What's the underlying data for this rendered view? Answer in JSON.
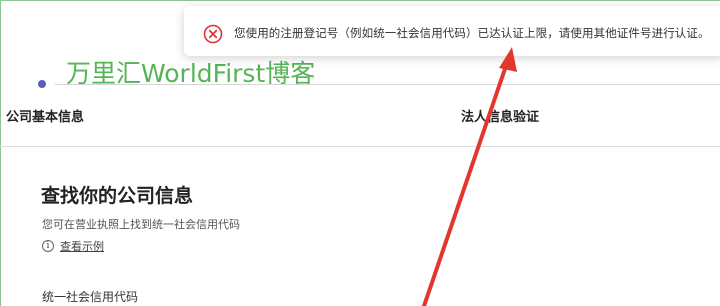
{
  "toast": {
    "message": "您使用的注册登记号（例如统一社会信用代码）已达认证上限，请使用其他证件号进行认证。",
    "icon": "error-circle-icon",
    "icon_color": "#e0323a"
  },
  "watermark": {
    "text": "万里汇WorldFirst博客",
    "color": "#55b455"
  },
  "steps": {
    "step1_label": "公司基本信息",
    "step2_label": "法人信息验证"
  },
  "section": {
    "title": "查找你的公司信息",
    "subtitle": "您可在营业执照上找到统一社会信用代码",
    "example_link": "查看示例",
    "info_icon": "info-circle-icon"
  },
  "form": {
    "credit_code_label": "统一社会信用代码"
  },
  "annotation": {
    "arrow_color": "#e2372f",
    "arrow_icon": "red-arrow-annotation"
  }
}
